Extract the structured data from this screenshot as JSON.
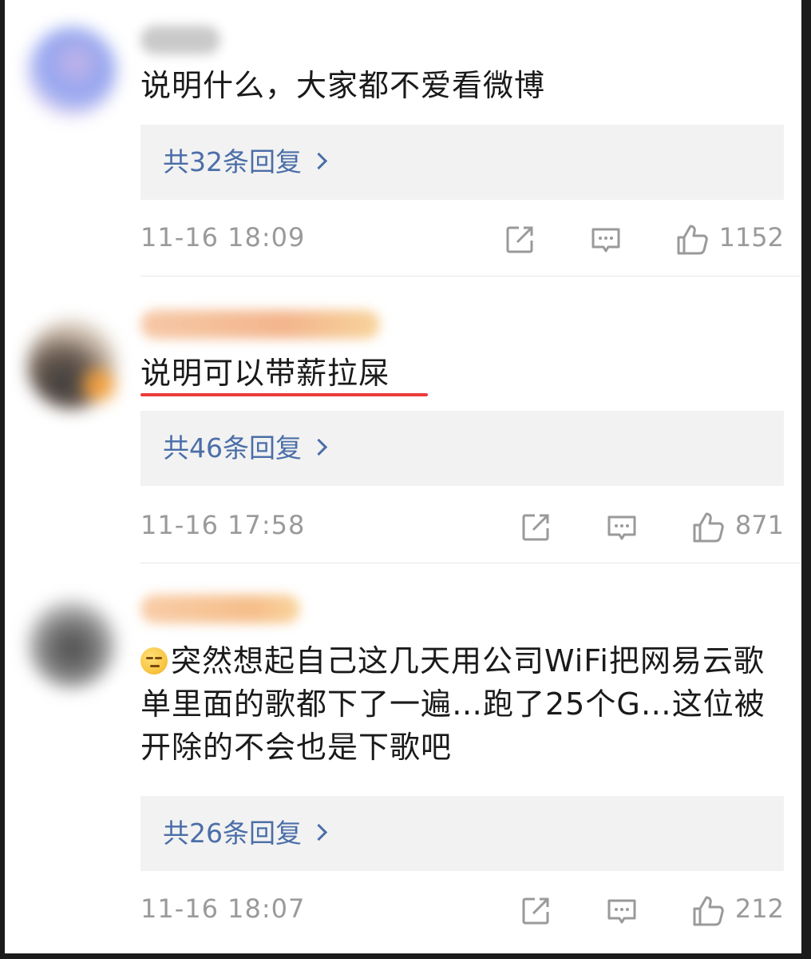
{
  "comments": [
    {
      "text": "说明什么，大家都不爱看微博",
      "replies_label": "共32条回复",
      "time": "11-16 18:09",
      "likes": "1152"
    },
    {
      "text": "说明可以带薪拉屎",
      "replies_label": "共46条回复",
      "time": "11-16 17:58",
      "likes": "871"
    },
    {
      "text": "突然想起自己这几天用公司WiFi把网易云歌单里面的歌都下了一遍…跑了25个G…这位被开除的不会也是下歌吧",
      "emoji": "sweat-smile-emoji",
      "replies_label": "共26条回复",
      "time": "11-16 18:07",
      "likes": "212"
    }
  ],
  "colors": {
    "link": "#4b6ea8",
    "underline": "#ec3b3b",
    "meta": "#9a9a9a"
  }
}
